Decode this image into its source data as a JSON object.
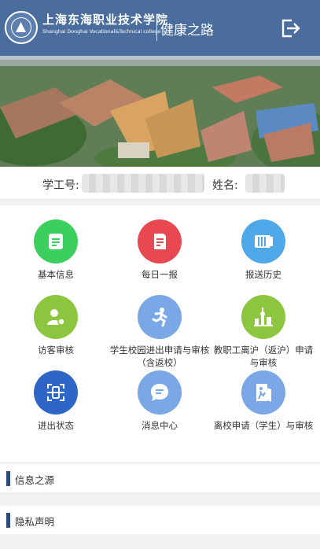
{
  "header": {
    "school_name_cn": "上海东海职业技术学院",
    "school_name_en": "Shanghai Donghai Vocational&Technical college",
    "app_title": "健康之路"
  },
  "user": {
    "id_label": "学工号:",
    "name_label": "姓名:"
  },
  "menu": [
    {
      "label": "基本信息",
      "color": "#3dcf5d",
      "icon": "id-card-icon"
    },
    {
      "label": "每日一报",
      "color": "#e8484f",
      "icon": "report-icon"
    },
    {
      "label": "报送历史",
      "color": "#4fa8e8",
      "icon": "history-icon"
    },
    {
      "label": "访客审核",
      "color": "#8cc63f",
      "icon": "visitor-icon"
    },
    {
      "label": "学生校园进出申请与审核（含返校）",
      "color": "#7aa7e6",
      "icon": "running-person-icon"
    },
    {
      "label": "教职工离沪（返沪）申请与审核",
      "color": "#8cc63f",
      "icon": "city-icon"
    },
    {
      "label": "进出状态",
      "color": "#2e66c7",
      "icon": "scan-icon"
    },
    {
      "label": "消息中心",
      "color": "#7aa7e6",
      "icon": "message-icon"
    },
    {
      "label": "离校申请（学生）与审核",
      "color": "#7aa7e6",
      "icon": "exit-door-icon"
    }
  ],
  "links": [
    {
      "label": "信息之源"
    },
    {
      "label": "隐私声明"
    }
  ],
  "colors": {
    "header_bg": "#4a6d9d",
    "section_bar": "#2d4a7a"
  }
}
